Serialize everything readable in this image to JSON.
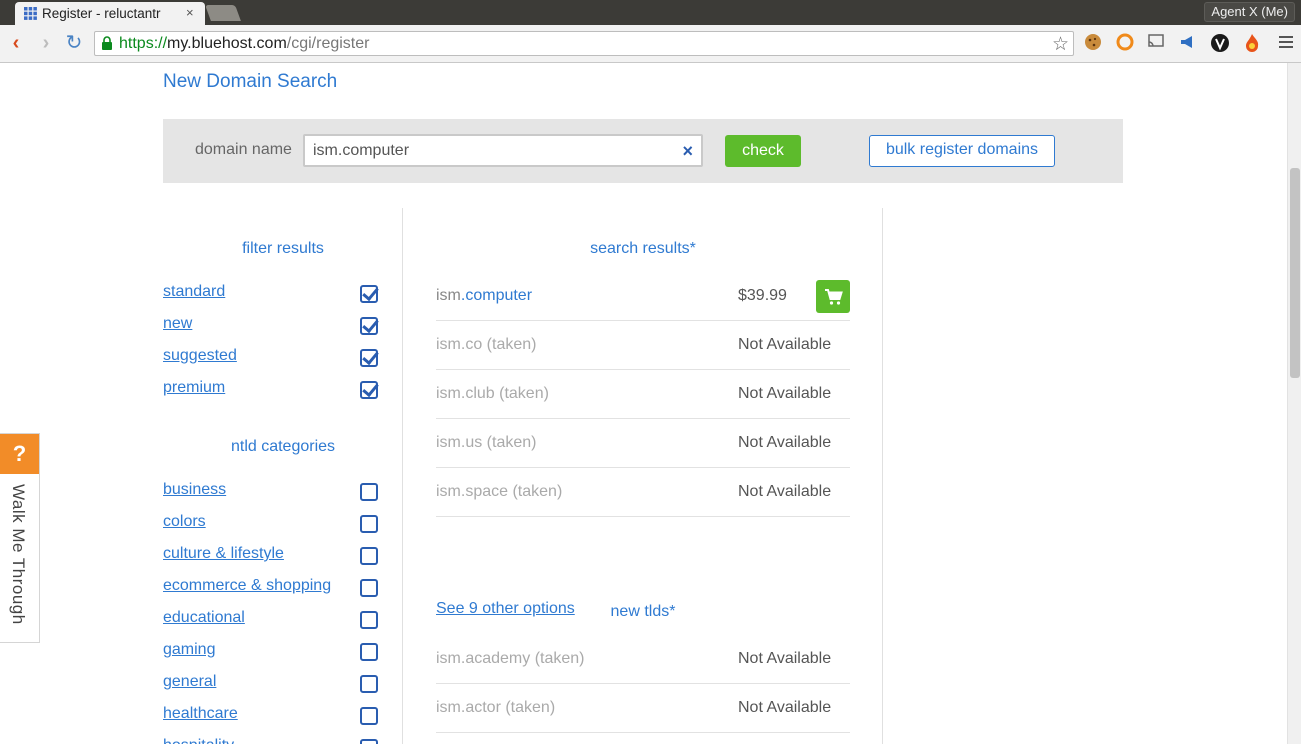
{
  "browser": {
    "tab_title": "Register - reluctantr",
    "tab_close": "×",
    "profile": "Agent X (Me)",
    "url_scheme": "https://",
    "url_host": "my.bluehost.com",
    "url_path": "/cgi/register",
    "star": "☆",
    "back": "‹",
    "forward": "›",
    "reload": "↻"
  },
  "page": {
    "title": "New Domain Search"
  },
  "search": {
    "label": "domain name",
    "value": "ism.computer",
    "clear": "×",
    "check_label": "check",
    "bulk_label": "bulk register domains"
  },
  "filters": {
    "heading": "filter results",
    "items": [
      {
        "label": "standard",
        "checked": true
      },
      {
        "label": "new",
        "checked": true
      },
      {
        "label": "suggested",
        "checked": true
      },
      {
        "label": "premium",
        "checked": true
      }
    ]
  },
  "ntld": {
    "heading": "ntld categories",
    "items": [
      {
        "label": "business"
      },
      {
        "label": "colors"
      },
      {
        "label": "culture & lifestyle"
      },
      {
        "label": "ecommerce & shopping"
      },
      {
        "label": "educational"
      },
      {
        "label": "gaming"
      },
      {
        "label": "general"
      },
      {
        "label": "healthcare"
      },
      {
        "label": "hospitality"
      }
    ]
  },
  "results": {
    "heading": "search results*",
    "rows": [
      {
        "sld": "ism",
        "tld": ".computer",
        "taken": "",
        "status": "$39.99"
      },
      {
        "sld": "ism.co",
        "tld": "",
        "taken": " (taken)",
        "status": "Not Available"
      },
      {
        "sld": "ism.club",
        "tld": "",
        "taken": " (taken)",
        "status": "Not Available"
      },
      {
        "sld": "ism.us",
        "tld": "",
        "taken": " (taken)",
        "status": "Not Available"
      },
      {
        "sld": "ism.space",
        "tld": "",
        "taken": " (taken)",
        "status": "Not Available"
      }
    ],
    "see_other": "See 9 other options",
    "new_tlds_heading": "new tlds*",
    "new_rows": [
      {
        "sld": "ism.academy",
        "tld": "",
        "taken": " (taken)",
        "status": "Not Available"
      },
      {
        "sld": "ism.actor",
        "tld": "",
        "taken": " (taken)",
        "status": "Not Available"
      }
    ]
  },
  "walkme": {
    "icon": "?",
    "label": "Walk Me Through"
  },
  "colors": {
    "link_blue": "#2f7ad1",
    "green": "#5dbb2c",
    "walkme_orange": "#f28c28"
  }
}
